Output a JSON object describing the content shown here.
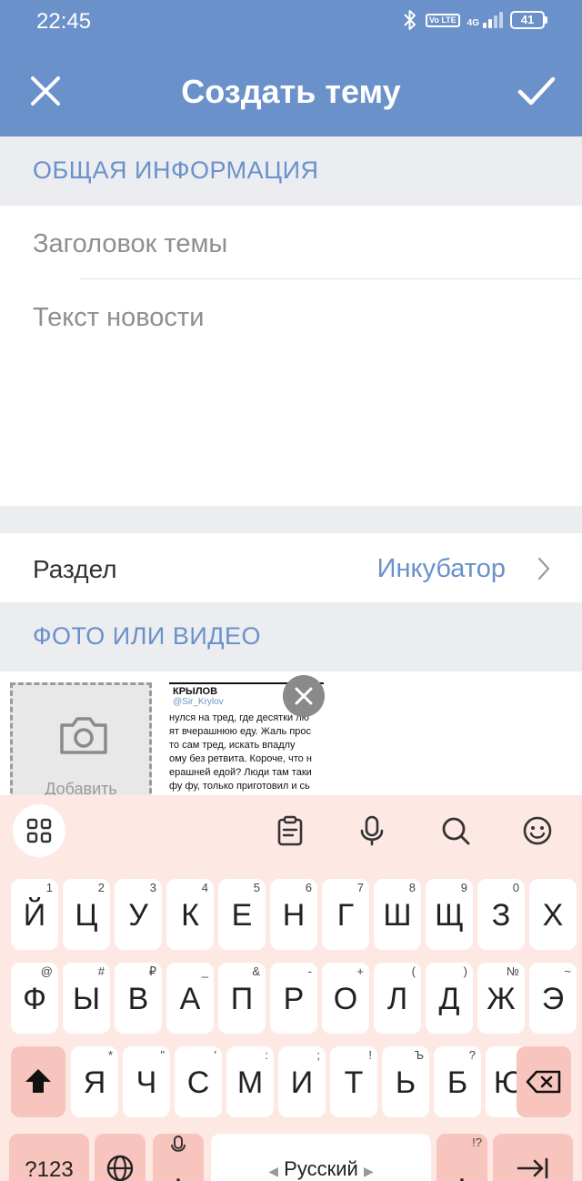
{
  "status_bar": {
    "time": "22:45",
    "network": "4G",
    "volte": "Vo LTE",
    "battery": "41"
  },
  "app_bar": {
    "title": "Создать тему"
  },
  "general_section": {
    "header": "ОБЩАЯ ИНФОРМАЦИЯ",
    "title_placeholder": "Заголовок темы",
    "text_placeholder": "Текст новости"
  },
  "section_row": {
    "label": "Раздел",
    "value": "Инкубатор"
  },
  "media_section": {
    "header": "ФОТО ИЛИ ВИДЕО",
    "add_label": "Добавить",
    "thumb": {
      "name": "КРЫЛОВ",
      "handle": "@Sir_Krylov",
      "lines": [
        "нулся на тред, где десятки лю",
        "ят вчерашнюю еду. Жаль прос",
        "то сам тред, искать впадлу",
        "ому без ретвита. Короче, что н",
        "ерашней едой? Люди там таки",
        " фу фу, только приготовил и сь"
      ]
    }
  },
  "keyboard": {
    "row1": [
      {
        "k": "Й",
        "h": "1"
      },
      {
        "k": "Ц",
        "h": "2"
      },
      {
        "k": "У",
        "h": "3"
      },
      {
        "k": "К",
        "h": "4"
      },
      {
        "k": "Е",
        "h": "5"
      },
      {
        "k": "Н",
        "h": "6"
      },
      {
        "k": "Г",
        "h": "7"
      },
      {
        "k": "Ш",
        "h": "8"
      },
      {
        "k": "Щ",
        "h": "9"
      },
      {
        "k": "З",
        "h": "0"
      },
      {
        "k": "Х",
        "h": ""
      }
    ],
    "row2": [
      {
        "k": "Ф",
        "h": "@"
      },
      {
        "k": "Ы",
        "h": "#"
      },
      {
        "k": "В",
        "h": "₽"
      },
      {
        "k": "А",
        "h": "_"
      },
      {
        "k": "П",
        "h": "&"
      },
      {
        "k": "Р",
        "h": "-"
      },
      {
        "k": "О",
        "h": "+"
      },
      {
        "k": "Л",
        "h": "("
      },
      {
        "k": "Д",
        "h": ")"
      },
      {
        "k": "Ж",
        "h": "№"
      },
      {
        "k": "Э",
        "h": "~"
      }
    ],
    "row3": [
      {
        "k": "Я",
        "h": "*"
      },
      {
        "k": "Ч",
        "h": "\""
      },
      {
        "k": "С",
        "h": "'"
      },
      {
        "k": "М",
        "h": ":"
      },
      {
        "k": "И",
        "h": ";"
      },
      {
        "k": "Т",
        "h": "!"
      },
      {
        "k": "Ь",
        "h": "Ъ"
      },
      {
        "k": "Б",
        "h": "?"
      },
      {
        "k": "Ю",
        "h": "%"
      }
    ],
    "symbols_label": "?123",
    "comma_key": ",",
    "space_label": "Русский",
    "period_key": ".",
    "period_hint": "!?"
  }
}
